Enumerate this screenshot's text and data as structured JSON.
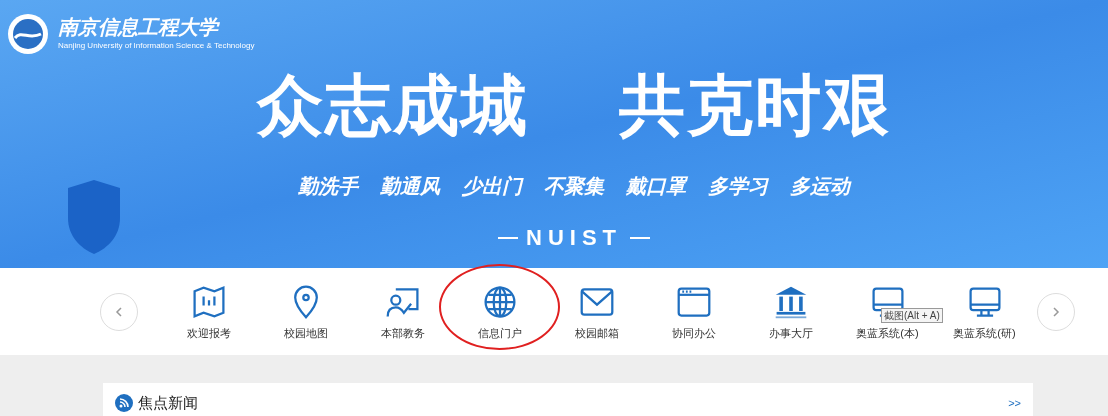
{
  "banner": {
    "logo_name": "南京信息工程大学",
    "logo_name_en": "Nanjing University of Information Science & Technology",
    "slogan": [
      "众志成城",
      "共克时艰"
    ],
    "sub_slogans": [
      "勤洗手",
      "勤通风",
      "少出门",
      "不聚集",
      "戴口罩",
      "多学习",
      "多运动"
    ],
    "tag": "NUIST"
  },
  "nav": {
    "items": [
      {
        "label": "欢迎报考",
        "circled": false
      },
      {
        "label": "校园地图",
        "circled": false
      },
      {
        "label": "本部教务",
        "circled": false
      },
      {
        "label": "信息门户",
        "circled": true
      },
      {
        "label": "校园邮箱",
        "circled": false
      },
      {
        "label": "协同办公",
        "circled": false
      },
      {
        "label": "办事大厅",
        "circled": false
      },
      {
        "label": "奥蓝系统(本)",
        "circled": false
      },
      {
        "label": "奥蓝系统(研)",
        "circled": false
      }
    ],
    "tooltip": "截图(Alt + A)"
  },
  "news": {
    "title": "焦点新闻",
    "more": ">>"
  }
}
